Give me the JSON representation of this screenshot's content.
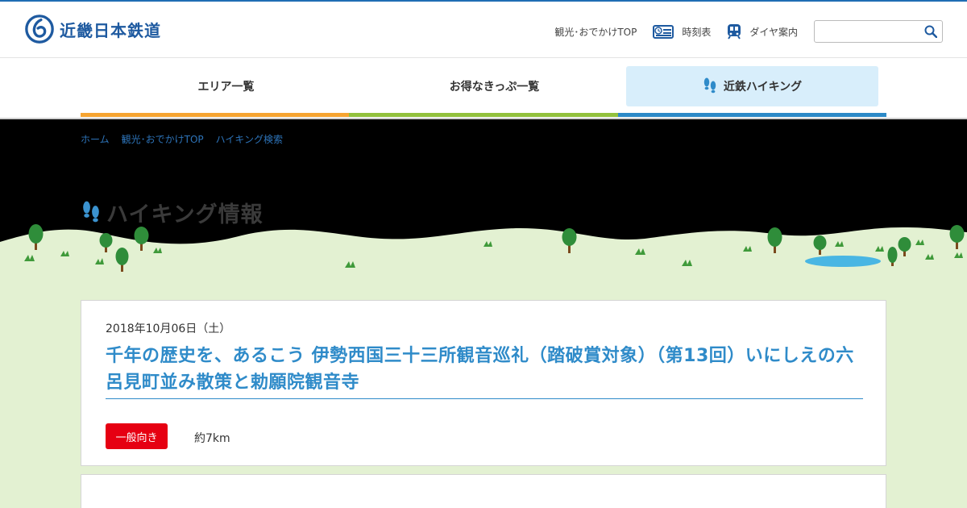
{
  "header": {
    "logo_text": "近畿日本鉄道",
    "links": [
      {
        "label": "観光･おでかけTOP"
      },
      {
        "label": "時刻表",
        "icon": "timetable-icon"
      },
      {
        "label": "ダイヤ案内",
        "icon": "train-icon"
      }
    ],
    "search": {
      "placeholder": "",
      "value": ""
    }
  },
  "nav": {
    "items": [
      {
        "label": "エリア一覧",
        "accent": "#f6a431"
      },
      {
        "label": "お得なきっぷ一覧",
        "accent": "#92c13d"
      },
      {
        "label": "近鉄ハイキング",
        "accent": "#2c8ac8",
        "active": true
      }
    ]
  },
  "breadcrumb": [
    "ホーム",
    "観光･おでかけTOP",
    "ハイキング検索"
  ],
  "hero": {
    "title": "ハイキング情報"
  },
  "event": {
    "date": "2018年10月06日（土）",
    "title": "千年の歴史を、あるこう 伊勢西国三十三所観音巡礼（踏破賞対象）（第13回）いにしえの六呂見町並み散策と勅願院観音寺",
    "level": "一般向き",
    "distance": "約7km"
  },
  "colors": {
    "brand": "#1e5aa0",
    "title_blue": "#2f8bc9",
    "badge_red": "#e60012",
    "grass": "#e3f1d2"
  }
}
